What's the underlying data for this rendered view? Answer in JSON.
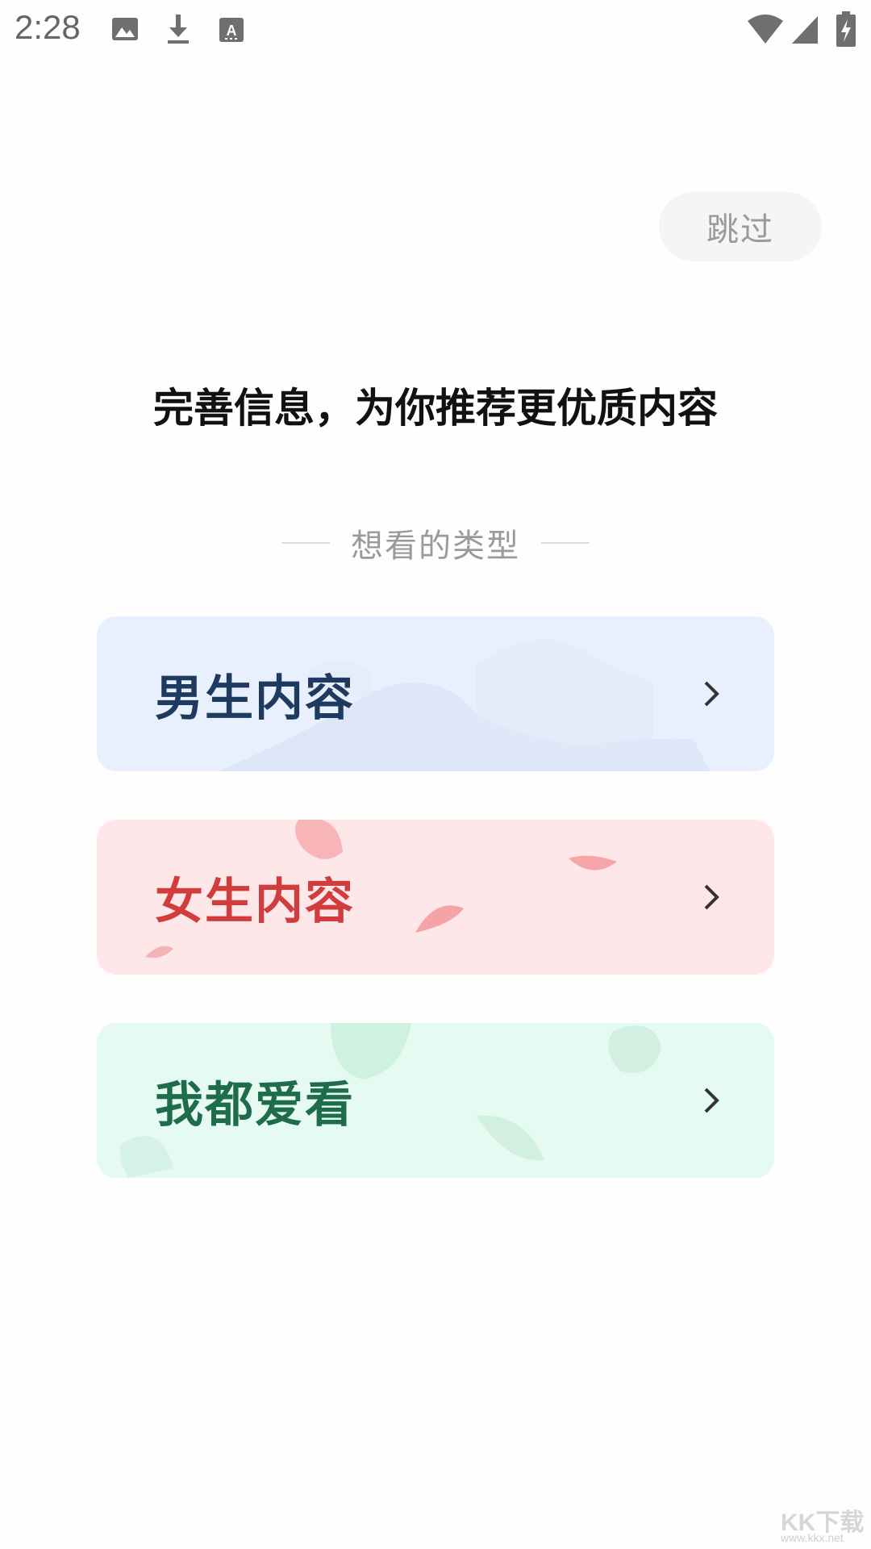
{
  "status_bar": {
    "time": "2:28",
    "left_icons": [
      "image-icon",
      "download-icon",
      "keyboard-a-icon"
    ],
    "right_icons": [
      "wifi-icon",
      "cell-signal-icon",
      "battery-charging-icon"
    ]
  },
  "skip_button": {
    "label": "跳过"
  },
  "headline": "完善信息，为你推荐更优质内容",
  "section_label": "想看的类型",
  "cards": [
    {
      "label": "男生内容",
      "text_color": "#1f3a5f",
      "bg_color": "#e8effd",
      "decoration": "mountains"
    },
    {
      "label": "女生内容",
      "text_color": "#d13d3d",
      "bg_color": "#fde7e8",
      "decoration": "petals"
    },
    {
      "label": "我都爱看",
      "text_color": "#1e6b4e",
      "bg_color": "#e5fbf1",
      "decoration": "leaves"
    }
  ],
  "watermark": {
    "logo_text": "KK下载",
    "url": "www.kkx.net"
  }
}
